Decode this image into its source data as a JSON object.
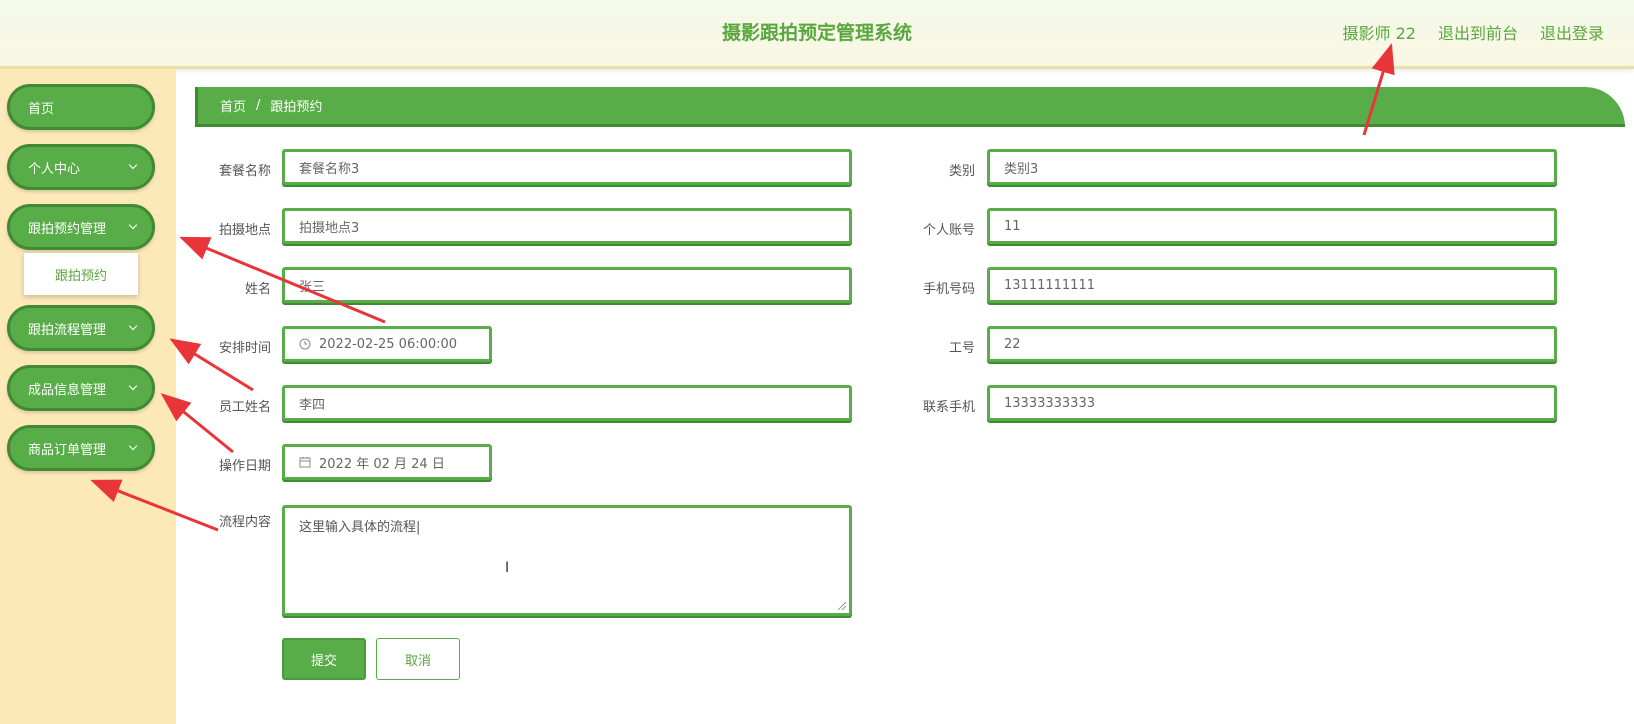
{
  "header": {
    "title": "摄影跟拍预定管理系统",
    "links": [
      "摄影师 22",
      "退出到前台",
      "退出登录"
    ]
  },
  "sidebar": {
    "items": [
      {
        "label": "首页",
        "has_chevron": false
      },
      {
        "label": "个人中心",
        "has_chevron": true
      },
      {
        "label": "跟拍预约管理",
        "has_chevron": true
      },
      {
        "label": "跟拍流程管理",
        "has_chevron": true
      },
      {
        "label": "成品信息管理",
        "has_chevron": true
      },
      {
        "label": "商品订单管理",
        "has_chevron": true
      }
    ],
    "submenu": {
      "label": "跟拍预约"
    }
  },
  "breadcrumb": {
    "home": "首页",
    "separator": "/",
    "current": "跟拍预约"
  },
  "form": {
    "package_name": {
      "label": "套餐名称",
      "value": "套餐名称3"
    },
    "category": {
      "label": "类别",
      "value": "类别3"
    },
    "location": {
      "label": "拍摄地点",
      "value": "拍摄地点3"
    },
    "account": {
      "label": "个人账号",
      "value": "11"
    },
    "name": {
      "label": "姓名",
      "value": "张三"
    },
    "phone": {
      "label": "手机号码",
      "value": "13111111111"
    },
    "schedule_time": {
      "label": "安排时间",
      "value": "2022-02-25 06:00:00"
    },
    "employee_no": {
      "label": "工号",
      "value": "22"
    },
    "employee_name": {
      "label": "员工姓名",
      "value": "李四"
    },
    "contact_phone": {
      "label": "联系手机",
      "value": "13333333333"
    },
    "operation_date": {
      "label": "操作日期",
      "value": "2022 年 02 月 24 日"
    },
    "process_content": {
      "label": "流程内容",
      "value": "这里输入具体的流程|"
    }
  },
  "buttons": {
    "submit": "提交",
    "cancel": "取消"
  },
  "colors": {
    "primary": "#59ad48",
    "primary_dark": "#3f8a33",
    "sidebar_bg": "#fde8b8",
    "annotation": "#e8353a"
  },
  "icons": {
    "time": "clock-icon",
    "date": "calendar-icon",
    "expand": "chevron-down-icon"
  }
}
